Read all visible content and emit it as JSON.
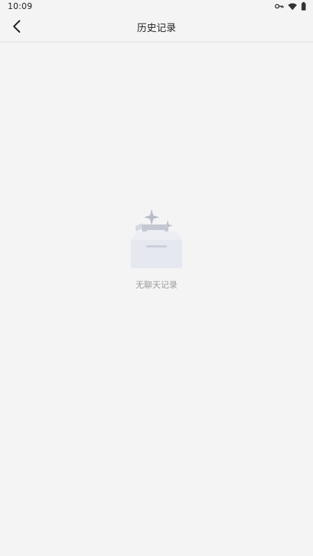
{
  "status_bar": {
    "time": "10:09",
    "icons": [
      "key-icon",
      "wifi-icon",
      "battery-icon"
    ]
  },
  "app_bar": {
    "back_icon": "chevron-left-icon",
    "title": "历史记录"
  },
  "empty_state": {
    "illustration": "empty-box-icon",
    "message": "无聊天记录"
  },
  "colors": {
    "background": "#f4f4f4",
    "title_text": "#222222",
    "empty_text": "#9a9a9a",
    "illustration_light": "#e6e8ef",
    "illustration_dark": "#b9bdc9"
  }
}
